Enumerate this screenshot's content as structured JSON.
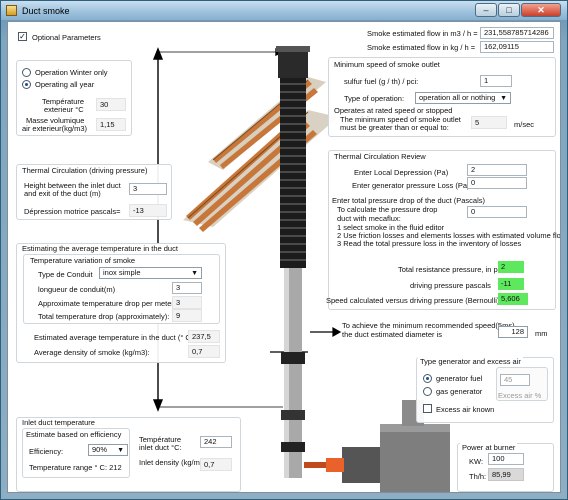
{
  "window": {
    "title": "Duct smoke",
    "minimize": "–",
    "maximize": "□",
    "close": "✕"
  },
  "optional": {
    "label": "Optional Parameters",
    "checked": true
  },
  "flow": {
    "m3_label": "Smoke estimated flow in m3 / h =",
    "m3_value": "231,558785714286",
    "kg_label": "Smoke estimated flow in kg / h =",
    "kg_value": "162,09115"
  },
  "operation": {
    "winter_label": "Operation Winter only",
    "all_year_label": "Operating all year",
    "selected": "all_year",
    "temp_label_1": "Température",
    "temp_label_2": "exterieur °C",
    "temp_value": "30",
    "mass_label_1": "Masse volumique",
    "mass_label_2": "air exterieur(kg/m3)",
    "mass_value": "1,15"
  },
  "min_speed": {
    "title": "Minimum speed of smoke outlet",
    "sulfur_label": "sulfur fuel (g / th) / pci:",
    "sulfur_value": "1",
    "type_label": "Type of operation:",
    "type_value": "operation all or nothing",
    "rated_label": "Operates at rated speed or stopped",
    "min_line1": "The minimum speed of smoke outlet",
    "min_line2": "must be greater than or equal to:",
    "min_value": "5",
    "min_unit": "m/sec"
  },
  "thermal": {
    "title": "Thermal Circulation (driving pressure)",
    "height_label_1": "Height between the inlet duct",
    "height_label_2": "and exit of the duct (m)",
    "height_value": "3",
    "depression_label": "Dépression motrice pascals=",
    "depression_value": "-13"
  },
  "review": {
    "title": "Thermal Circulation Review",
    "local_label": "Enter Local Depression (Pa)",
    "local_value": "2",
    "gen_loss_label": "Enter  generator pressure Loss (Pa)",
    "gen_loss_value": "0",
    "total_drop_label": "Enter total pressure drop of the duct (Pascals)",
    "calc_line1": "To calculate the pressure drop",
    "calc_line2": "duct with mecaflux:",
    "calc_value": "0",
    "step1": "1 select  smoke in the fluid editor",
    "step2": "2 Use friction losses and elements losses with estimated volume flow",
    "step3": "3 Read the total pressure loss in the inventory of losses",
    "resistance_label": "Total resistance pressure, in pasc",
    "resistance_value": "2",
    "driving_label": "driving pressure pascals",
    "driving_value": "-11",
    "speed_label": "Speed calculated versus driving pressure (Bernoulli) ms",
    "speed_value": "5,606"
  },
  "diameter": {
    "line1": "To achieve the minimum recommended speed(5ms)",
    "line2": "the duct estimated diameter is",
    "value": "128",
    "unit": "mm"
  },
  "avg_temp": {
    "title": "Estimating the average temperature in the duct",
    "variation_title": "Temperature variation of smoke",
    "conduit_label": "Type de Conduit",
    "conduit_value": "inox simple",
    "length_label": "longueur de conduit(m)",
    "length_value": "3",
    "drop_meter_label": "Approximate temperature drop per meter:",
    "drop_meter_value": "3",
    "total_drop_label": "Total temperature drop (approximately):",
    "total_drop_value": "9",
    "estimated_label": "Estimated average temperature in the duct (° C)",
    "estimated_value": "237,5",
    "density_label": "Average density of smoke (kg/m3):",
    "density_value": "0,7"
  },
  "generator": {
    "title": "Type generator and excess air",
    "fuel_label": "generator fuel",
    "gas_label": "gas generator",
    "selected": "fuel",
    "excess_value": "45",
    "excess_caption": "Excess air %",
    "excess_known_label": "Excess air known",
    "excess_known_checked": false
  },
  "inlet": {
    "title": "Inlet duct temperature",
    "estimate_label": "Estimate based on efficiency",
    "efficiency_label": "Efficiency:",
    "efficiency_value": "90%",
    "inlet_temp_label_1": "Température",
    "inlet_temp_label_2": "inlet duct °C:",
    "inlet_temp_value": "242",
    "range_label": "Temperature range ° C: 212",
    "density_label": "Inlet density (kg/m3):",
    "density_value": "0,7"
  },
  "power": {
    "title": "Power at burner",
    "kw_label": "KW:",
    "kw_value": "100",
    "th_label": "Th/h:",
    "th_value": "85,99"
  },
  "colors": {
    "accent_green": "#5ee85e",
    "burner_orange": "#e8622a",
    "roof_tiles": "#c8773b"
  }
}
